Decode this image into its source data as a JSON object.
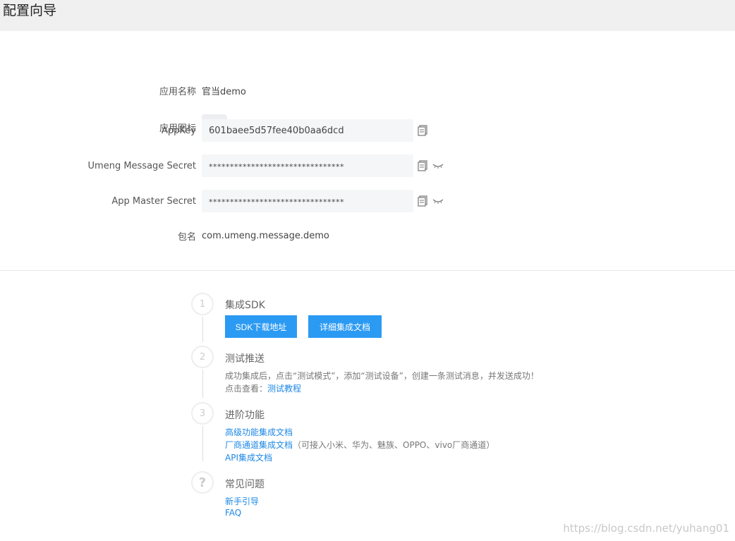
{
  "header": {
    "title": "配置向导"
  },
  "form": {
    "app_name": {
      "label": "应用名称",
      "value": "官当demo"
    },
    "app_icon": {
      "label": "应用图标"
    },
    "app_key": {
      "label": "AppKey",
      "value": "601baee5d57fee40b0aa6dcd"
    },
    "message_secret": {
      "label": "Umeng Message Secret",
      "value": "********************************"
    },
    "master_secret": {
      "label": "App Master Secret",
      "value": "********************************"
    },
    "package": {
      "label": "包名",
      "value": "com.umeng.message.demo"
    }
  },
  "steps": {
    "s1": {
      "num": "1",
      "title": "集成SDK",
      "btn_download": "SDK下载地址",
      "btn_docs": "详细集成文档"
    },
    "s2": {
      "num": "2",
      "title": "测试推送",
      "desc": "成功集成后，点击“测试模式”，添加“测试设备”，创建一条测试消息，并发送成功！",
      "view_prefix": "点击查看：",
      "view_link": "测试教程"
    },
    "s3": {
      "num": "3",
      "title": "进阶功能",
      "link_advanced": "高级功能集成文档",
      "link_vendor": "厂商通道集成文档",
      "vendor_note": "（可接入小米、华为、魅族、OPPO、vivo厂商通道）",
      "link_api": "API集成文档"
    },
    "s4": {
      "num": "?",
      "title": "常见问题",
      "link_guide": "新手引导",
      "link_faq": "FAQ"
    }
  },
  "watermark": "https://blog.csdn.net/yuhang01"
}
